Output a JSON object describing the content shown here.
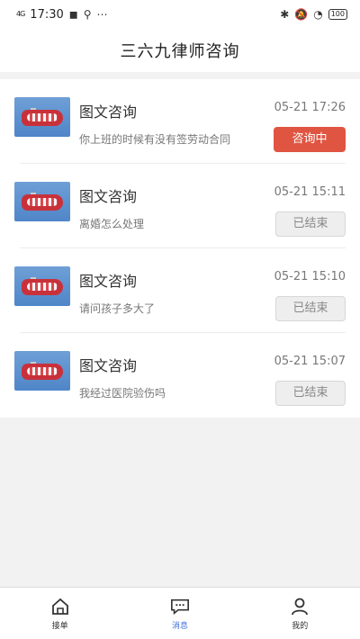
{
  "status_bar": {
    "time": "17:30",
    "signal": "4G",
    "battery": "100"
  },
  "header": {
    "title": "三六九律师咨询"
  },
  "consultations": [
    {
      "title": "图文咨询",
      "message": "你上班的时候有没有签劳动合同",
      "time": "05-21 17:26",
      "status": "咨询中",
      "status_type": "active"
    },
    {
      "title": "图文咨询",
      "message": "离婚怎么处理",
      "time": "05-21 15:11",
      "status": "已结束",
      "status_type": "done"
    },
    {
      "title": "图文咨询",
      "message": "请问孩子多大了",
      "time": "05-21 15:10",
      "status": "已结束",
      "status_type": "done"
    },
    {
      "title": "图文咨询",
      "message": "我经过医院验伤吗",
      "time": "05-21 15:07",
      "status": "已结束",
      "status_type": "done"
    }
  ],
  "tabbar": {
    "items": [
      {
        "label": "接单",
        "icon": "home-icon"
      },
      {
        "label": "消息",
        "icon": "chat-icon"
      },
      {
        "label": "我的",
        "icon": "user-icon"
      }
    ]
  },
  "colors": {
    "accent": "#e05542",
    "active_tab": "#3c6fd6"
  }
}
